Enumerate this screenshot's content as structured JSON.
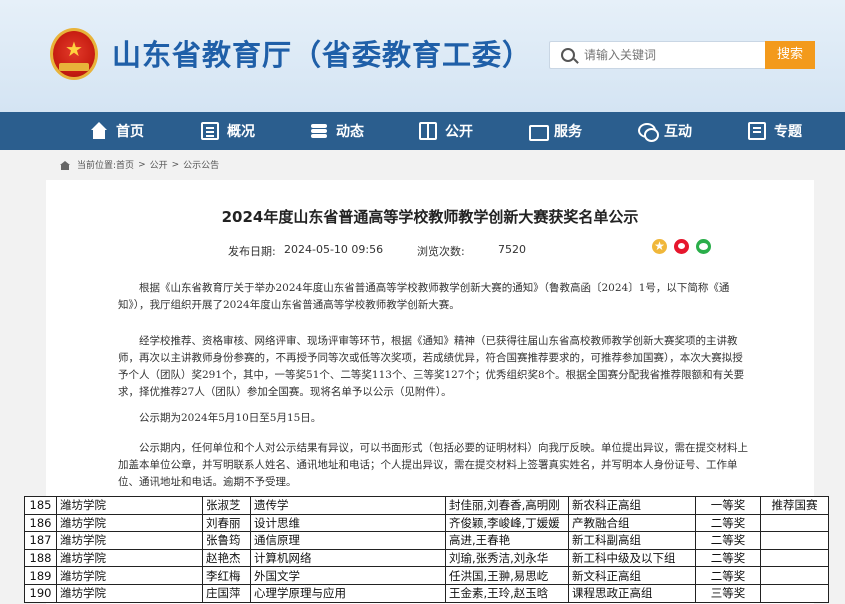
{
  "site": {
    "title": "山东省教育厅（省委教育工委）",
    "search_placeholder": "请输入关键词",
    "search_button": "搜索",
    "brand_color": "#2b5e8e",
    "accent_color": "#f39a1c"
  },
  "nav": [
    {
      "label": "首页",
      "icon": "home-icon"
    },
    {
      "label": "概况",
      "icon": "overview-icon"
    },
    {
      "label": "动态",
      "icon": "layers-icon"
    },
    {
      "label": "公开",
      "icon": "book-icon"
    },
    {
      "label": "服务",
      "icon": "service-icon"
    },
    {
      "label": "互动",
      "icon": "chat-icon"
    },
    {
      "label": "专题",
      "icon": "topic-icon"
    }
  ],
  "breadcrumb": {
    "prefix": "当前位置:",
    "items": [
      "首页",
      "公开",
      "公示公告"
    ],
    "sep": ">"
  },
  "article": {
    "title": "2024年度山东省普通高等学校教师教学创新大赛获奖名单公示",
    "publish_label": "发布日期:",
    "publish_date": "2024-05-10 09:56",
    "views_label": "浏览次数:",
    "views": "7520",
    "paragraphs": [
      "根据《山东省教育厅关于举办2024年度山东省普通高等学校教师教学创新大赛的通知》（鲁教高函〔2024〕1号，以下简称《通知》），我厅组织开展了2024年度山东省普通高等学校教师教学创新大赛。",
      "经学校推荐、资格审核、网络评审、现场评审等环节，根据《通知》精神（已获得往届山东省高校教师教学创新大赛奖项的主讲教师，再次以主讲教师身份参赛的，不再授予同等次或低等次奖项，若成绩优异，符合国赛推荐要求的，可推荐参加国赛），本次大赛拟授予个人（团队）奖291个，其中，一等奖51个、二等奖113个、三等奖127个；优秀组织奖8个。根据全国赛分配我省推荐限额和有关要求，择优推荐27人（团队）参加全国赛。现将名单予以公示（见附件）。",
      "公示期为2024年5月10日至5月15日。",
      "公示期内，任何单位和个人对公示结果有异议，可以书面形式（包括必要的证明材料）向我厅反映。单位提出异议，需在提交材料上加盖本单位公章，并写明联系人姓名、通讯地址和电话；个人提出异议，需在提交材料上签署真实姓名，并写明本人身份证号、工作单位、通讯地址和电话。逾期不予受理。"
    ]
  },
  "table": {
    "rows": [
      [
        "185",
        "潍坊学院",
        "张淑芝",
        "遗传学",
        "封佳丽,刘春香,高明刚",
        "新农科正高组",
        "一等奖",
        "推荐国赛"
      ],
      [
        "186",
        "潍坊学院",
        "刘春丽",
        "设计思维",
        "齐俊颖,李峻峰,丁媛媛",
        "产教融合组",
        "二等奖",
        ""
      ],
      [
        "187",
        "潍坊学院",
        "张鲁筠",
        "通信原理",
        "高进,王春艳",
        "新工科副高组",
        "二等奖",
        ""
      ],
      [
        "188",
        "潍坊学院",
        "赵艳杰",
        "计算机网络",
        "刘瑜,张秀洁,刘永华",
        "新工科中级及以下组",
        "二等奖",
        ""
      ],
      [
        "189",
        "潍坊学院",
        "李红梅",
        "外国文学",
        "任洪国,王翀,易思屹",
        "新文科正高组",
        "二等奖",
        ""
      ],
      [
        "190",
        "潍坊学院",
        "庄国萍",
        "心理学原理与应用",
        "王金素,王玲,赵玉晗",
        "课程思政正高组",
        "三等奖",
        ""
      ]
    ]
  }
}
